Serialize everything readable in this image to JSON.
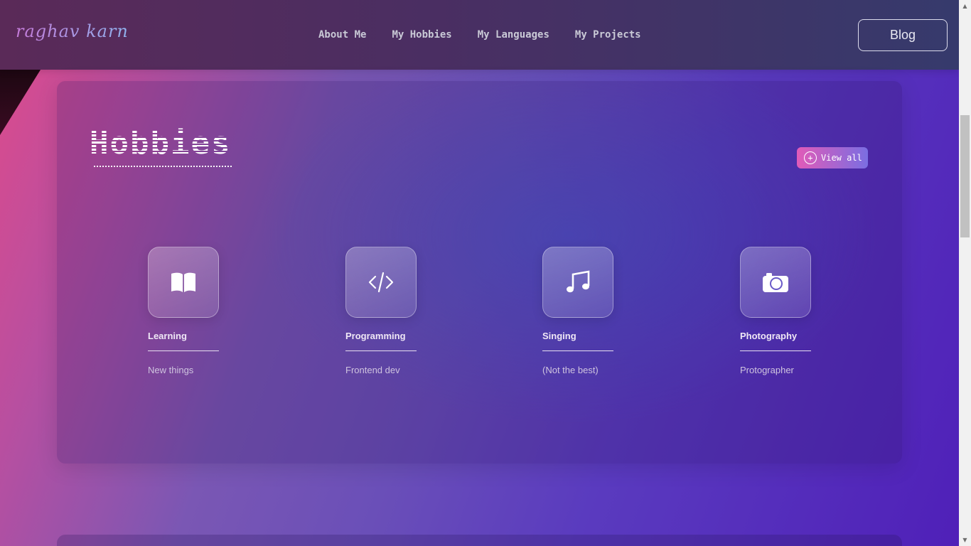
{
  "logo": {
    "text": "raghav karn"
  },
  "nav": {
    "links": [
      "About Me",
      "My Hobbies",
      "My Languages",
      "My Projects"
    ],
    "blog_label": "Blog"
  },
  "section": {
    "title": "Hobbies",
    "view_all_label": "View all"
  },
  "hobbies": [
    {
      "name": "Learning",
      "description": "New things",
      "icon": "book-icon"
    },
    {
      "name": "Programming",
      "description": "Frontend dev",
      "icon": "code-icon"
    },
    {
      "name": "Singing",
      "description": "(Not the best)",
      "icon": "music-note-icon"
    },
    {
      "name": "Photography",
      "description": "Protographer",
      "icon": "camera-icon"
    }
  ],
  "colors": {
    "accent_pink": "#e15bb8",
    "accent_blue": "#7a6ee2",
    "background_start": "#e04a8a",
    "background_end": "#4f1fb8"
  }
}
